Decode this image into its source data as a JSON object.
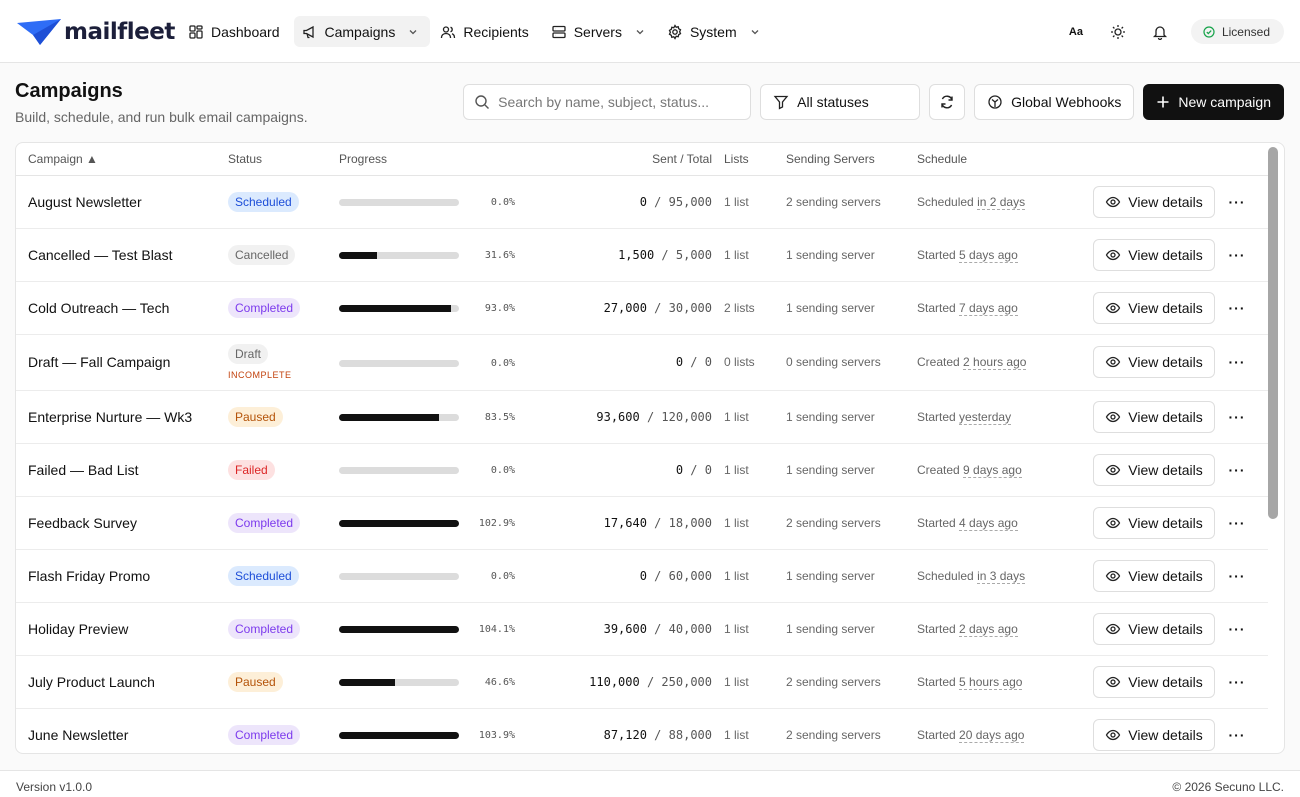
{
  "app": {
    "logo_text": "mailfleet"
  },
  "nav": [
    {
      "label": "Dashboard",
      "icon": "dashboard-icon",
      "dropdown": false,
      "active": false
    },
    {
      "label": "Campaigns",
      "icon": "megaphone-icon",
      "dropdown": true,
      "active": true
    },
    {
      "label": "Recipients",
      "icon": "users-icon",
      "dropdown": false,
      "active": false
    },
    {
      "label": "Servers",
      "icon": "server-icon",
      "dropdown": true,
      "active": false
    },
    {
      "label": "System",
      "icon": "gear-icon",
      "dropdown": true,
      "active": false
    }
  ],
  "topbar": {
    "font_size_icon_text": "Aa",
    "license_label": "Licensed"
  },
  "page": {
    "title": "Campaigns",
    "subtitle": "Build, schedule, and run bulk email campaigns."
  },
  "toolbar": {
    "search_placeholder": "Search by name, subject, status...",
    "status_filter": "All statuses",
    "webhooks_label": "Global Webhooks",
    "new_label": "New campaign"
  },
  "table": {
    "headers": {
      "campaign": "Campaign ▲",
      "status": "Status",
      "progress": "Progress",
      "sent_total": "Sent / Total",
      "lists": "Lists",
      "servers": "Sending Servers",
      "schedule": "Schedule"
    },
    "view_label": "View details",
    "more_label": "···",
    "rows": [
      {
        "name": "August Newsletter",
        "status": "Scheduled",
        "status_class": "b-scheduled",
        "note": "",
        "progress": 0.0,
        "pct": "0.0%",
        "sent": "0",
        "total": "95,000",
        "lists": "1 list",
        "servers": "2 sending servers",
        "sched_prefix": "Scheduled",
        "sched_rel": "in 2 days"
      },
      {
        "name": "Cancelled — Test Blast",
        "status": "Cancelled",
        "status_class": "b-cancelled",
        "note": "",
        "progress": 31.6,
        "pct": "31.6%",
        "sent": "1,500",
        "total": "5,000",
        "lists": "1 list",
        "servers": "1 sending server",
        "sched_prefix": "Started",
        "sched_rel": "5 days ago"
      },
      {
        "name": "Cold Outreach — Tech",
        "status": "Completed",
        "status_class": "b-completed",
        "note": "",
        "progress": 93.0,
        "pct": "93.0%",
        "sent": "27,000",
        "total": "30,000",
        "lists": "2 lists",
        "servers": "1 sending server",
        "sched_prefix": "Started",
        "sched_rel": "7 days ago"
      },
      {
        "name": "Draft — Fall Campaign",
        "status": "Draft",
        "status_class": "b-draft",
        "note": "INCOMPLETE",
        "progress": 0.0,
        "pct": "0.0%",
        "sent": "0",
        "total": "0",
        "lists": "0 lists",
        "servers": "0 sending servers",
        "sched_prefix": "Created",
        "sched_rel": "2 hours ago"
      },
      {
        "name": "Enterprise Nurture — Wk3",
        "status": "Paused",
        "status_class": "b-paused",
        "note": "",
        "progress": 83.5,
        "pct": "83.5%",
        "sent": "93,600",
        "total": "120,000",
        "lists": "1 list",
        "servers": "1 sending server",
        "sched_prefix": "Started",
        "sched_rel": "yesterday"
      },
      {
        "name": "Failed — Bad List",
        "status": "Failed",
        "status_class": "b-failed",
        "note": "",
        "progress": 0.0,
        "pct": "0.0%",
        "sent": "0",
        "total": "0",
        "lists": "1 list",
        "servers": "1 sending server",
        "sched_prefix": "Created",
        "sched_rel": "9 days ago"
      },
      {
        "name": "Feedback Survey",
        "status": "Completed",
        "status_class": "b-completed",
        "note": "",
        "progress": 102.9,
        "pct": "102.9%",
        "sent": "17,640",
        "total": "18,000",
        "lists": "1 list",
        "servers": "2 sending servers",
        "sched_prefix": "Started",
        "sched_rel": "4 days ago"
      },
      {
        "name": "Flash Friday Promo",
        "status": "Scheduled",
        "status_class": "b-scheduled",
        "note": "",
        "progress": 0.0,
        "pct": "0.0%",
        "sent": "0",
        "total": "60,000",
        "lists": "1 list",
        "servers": "1 sending server",
        "sched_prefix": "Scheduled",
        "sched_rel": "in 3 days"
      },
      {
        "name": "Holiday Preview",
        "status": "Completed",
        "status_class": "b-completed",
        "note": "",
        "progress": 104.1,
        "pct": "104.1%",
        "sent": "39,600",
        "total": "40,000",
        "lists": "1 list",
        "servers": "1 sending server",
        "sched_prefix": "Started",
        "sched_rel": "2 days ago"
      },
      {
        "name": "July Product Launch",
        "status": "Paused",
        "status_class": "b-paused",
        "note": "",
        "progress": 46.6,
        "pct": "46.6%",
        "sent": "110,000",
        "total": "250,000",
        "lists": "1 list",
        "servers": "2 sending servers",
        "sched_prefix": "Started",
        "sched_rel": "5 hours ago"
      },
      {
        "name": "June Newsletter",
        "status": "Completed",
        "status_class": "b-completed",
        "note": "",
        "progress": 103.9,
        "pct": "103.9%",
        "sent": "87,120",
        "total": "88,000",
        "lists": "1 list",
        "servers": "2 sending servers",
        "sched_prefix": "Started",
        "sched_rel": "20 days ago"
      }
    ]
  },
  "footer": {
    "version": "Version v1.0.0",
    "copyright": "© 2026 Secuno LLC."
  },
  "colors": {
    "primary": "#111111",
    "scheduled": "#1d4ed8",
    "completed": "#7c3aed",
    "paused": "#b45309",
    "failed": "#dc2626",
    "logo_blue": "#2f6df6"
  }
}
